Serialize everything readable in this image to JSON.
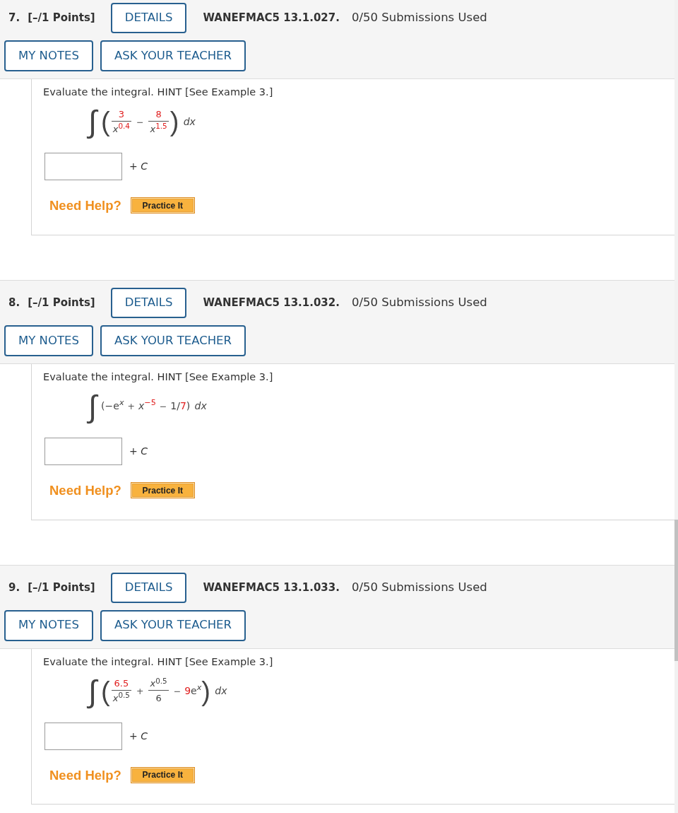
{
  "questions": [
    {
      "number": "7.",
      "points": "[–/1 Points]",
      "details_button": "DETAILS",
      "code": "WANEFMAC5 13.1.027.",
      "submissions": "0/50 Submissions Used",
      "notes_button": "MY NOTES",
      "ask_button": "ASK YOUR TEACHER",
      "prompt": "Evaluate the integral. HINT [See Example 3.]",
      "integral": {
        "sign": "∫",
        "terms": [
          {
            "kind": "paren",
            "text": "("
          },
          {
            "kind": "frac",
            "num": [
              {
                "kind": "text",
                "text": "3",
                "color": "#e01f1f"
              }
            ],
            "den": [
              {
                "kind": "var",
                "text": "x"
              },
              {
                "kind": "sup",
                "text": "0.4",
                "color": "#e01f1f"
              }
            ]
          },
          {
            "kind": "op",
            "text": "−"
          },
          {
            "kind": "frac",
            "num": [
              {
                "kind": "text",
                "text": "8",
                "color": "#e01f1f"
              }
            ],
            "den": [
              {
                "kind": "var",
                "text": "x"
              },
              {
                "kind": "sup",
                "text": "1.5",
                "color": "#e01f1f"
              }
            ]
          },
          {
            "kind": "paren",
            "text": ")"
          },
          {
            "kind": "diff",
            "text": "dx"
          }
        ]
      },
      "constant": "+ *C*",
      "help": "Need Help?",
      "practice_button": "Practice It"
    },
    {
      "number": "8.",
      "points": "[–/1 Points]",
      "details_button": "DETAILS",
      "code": "WANEFMAC5 13.1.032.",
      "submissions": "0/50 Submissions Used",
      "notes_button": "MY NOTES",
      "ask_button": "ASK YOUR TEACHER",
      "prompt": "Evaluate the integral. HINT [See Example 3.]",
      "integral": {
        "sign": "∫",
        "terms": [
          {
            "kind": "text",
            "text": "(−"
          },
          {
            "kind": "text",
            "text": "e"
          },
          {
            "kind": "supvar",
            "text": "x"
          },
          {
            "kind": "op",
            "text": "+"
          },
          {
            "kind": "var",
            "text": "x"
          },
          {
            "kind": "sup",
            "text": "−5",
            "color": "#e01f1f"
          },
          {
            "kind": "op",
            "text": "−"
          },
          {
            "kind": "text",
            "text": "1/"
          },
          {
            "kind": "text",
            "text": "7",
            "color": "#e01f1f"
          },
          {
            "kind": "text",
            "text": ")"
          },
          {
            "kind": "diff",
            "text": "dx"
          }
        ]
      },
      "constant": "+ *C*",
      "help": "Need Help?",
      "practice_button": "Practice It"
    },
    {
      "number": "9.",
      "points": "[–/1 Points]",
      "details_button": "DETAILS",
      "code": "WANEFMAC5 13.1.033.",
      "submissions": "0/50 Submissions Used",
      "notes_button": "MY NOTES",
      "ask_button": "ASK YOUR TEACHER",
      "prompt": "Evaluate the integral. HINT [See Example 3.]",
      "integral": {
        "sign": "∫",
        "terms": [
          {
            "kind": "paren",
            "text": "("
          },
          {
            "kind": "frac",
            "num": [
              {
                "kind": "text",
                "text": "6.5",
                "color": "#e01f1f"
              }
            ],
            "den": [
              {
                "kind": "var",
                "text": "x"
              },
              {
                "kind": "sup",
                "text": "0.5"
              }
            ]
          },
          {
            "kind": "op",
            "text": "+"
          },
          {
            "kind": "frac",
            "num": [
              {
                "kind": "var",
                "text": "x"
              },
              {
                "kind": "sup",
                "text": "0.5"
              }
            ],
            "den": [
              {
                "kind": "text",
                "text": "6"
              }
            ]
          },
          {
            "kind": "op",
            "text": "−"
          },
          {
            "kind": "text",
            "text": "9",
            "color": "#e01f1f"
          },
          {
            "kind": "text",
            "text": "e"
          },
          {
            "kind": "supvar",
            "text": "x"
          },
          {
            "kind": "paren",
            "text": ")"
          },
          {
            "kind": "diff",
            "text": "dx"
          }
        ]
      },
      "constant": "+ *C*",
      "help": "Need Help?",
      "practice_button": "Practice It"
    }
  ]
}
